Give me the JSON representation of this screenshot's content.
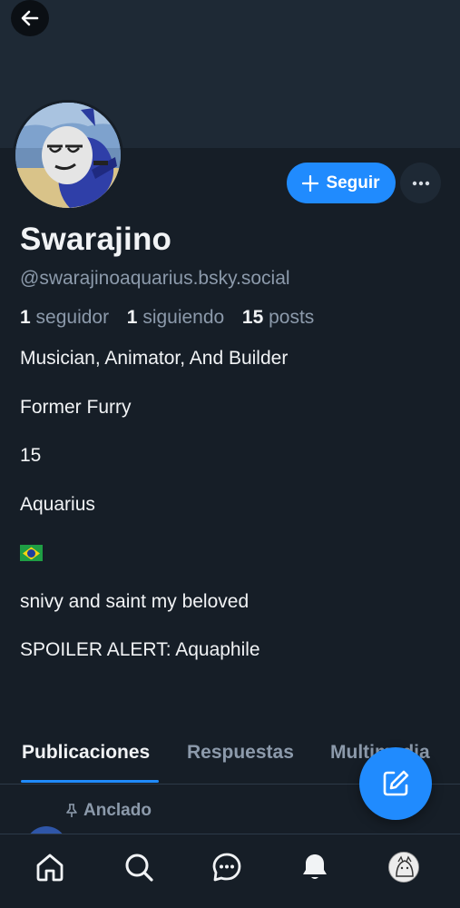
{
  "profile": {
    "display_name": "Swarajino",
    "handle": "@swarajinoaquarius.bsky.social",
    "stats": {
      "followers_count": "1",
      "followers_label": "seguidor",
      "following_count": "1",
      "following_label": "siguiendo",
      "posts_count": "15",
      "posts_label": "posts"
    },
    "bio": [
      "Musician, Animator, And Builder",
      "Former Furry",
      "15",
      "Aquarius",
      "🇧🇷",
      "snivy and saint my beloved",
      "SPOILER ALERT: Aquaphile"
    ]
  },
  "actions": {
    "follow_label": "Seguir",
    "more_icon": "ellipsis-icon"
  },
  "tabs": [
    {
      "label": "Publicaciones",
      "active": true
    },
    {
      "label": "Respuestas",
      "active": false
    },
    {
      "label": "Multimedia",
      "active": false
    }
  ],
  "feed": {
    "pinned_label": "Anclado"
  },
  "nav": {
    "items": [
      "home-icon",
      "search-icon",
      "chat-icon",
      "notifications-icon",
      "profile-avatar"
    ]
  },
  "colors": {
    "accent": "#208bfe",
    "background": "#161e27",
    "banner": "#1e2935",
    "muted_text": "#8c9aab"
  }
}
